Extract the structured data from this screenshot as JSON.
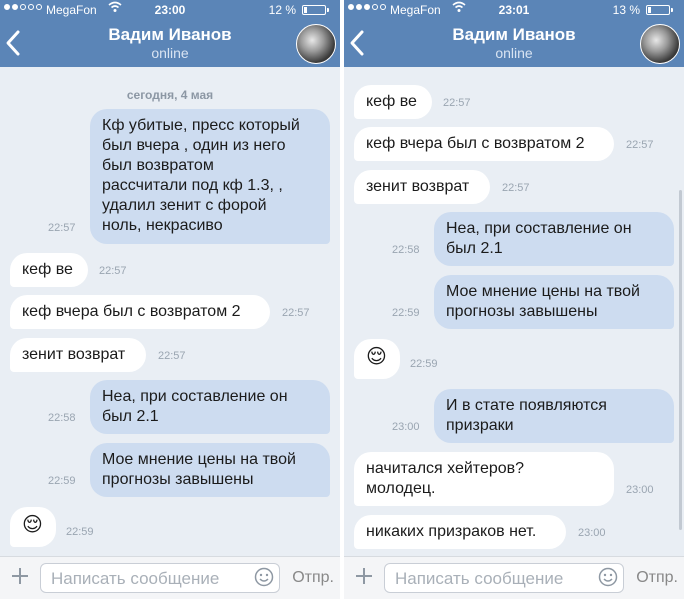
{
  "screens": [
    {
      "status": {
        "carrier": "MegaFon",
        "time": "23:00",
        "battery": "12 %"
      },
      "header": {
        "title": "Вадим Иванов",
        "subtitle": "online"
      },
      "date_separator": "сегодня, 4 мая",
      "messages": [
        {
          "text": "Кф убитые, пресс который\nбыл вчера , один из него\nбыл возвратом\nрассчитали под кф 1.3, ,\nудалил зенит с форой\nноль, некрасиво",
          "time": "22:57"
        },
        {
          "text": "кеф ве",
          "time": "22:57"
        },
        {
          "text": "кеф вчера был с возвратом 2",
          "time": "22:57"
        },
        {
          "text": "зенит возврат",
          "time": "22:57"
        },
        {
          "text": "Неа, при составление он\nбыл 2.1",
          "time": "22:58"
        },
        {
          "text": "Мое мнение цены на твой\nпрогнозы завышены",
          "time": "22:59"
        },
        {
          "text": "😌",
          "time": "22:59"
        }
      ],
      "input": {
        "placeholder": "Написать сообщение",
        "send_label": "Отпр."
      }
    },
    {
      "status": {
        "carrier": "MegaFon",
        "time": "23:01",
        "battery": "13 %"
      },
      "header": {
        "title": "Вадим Иванов",
        "subtitle": "online"
      },
      "messages": [
        {
          "text": "кеф ве",
          "time": "22:57"
        },
        {
          "text": "кеф вчера был с возвратом 2",
          "time": "22:57"
        },
        {
          "text": "зенит возврат",
          "time": "22:57"
        },
        {
          "text": "Неа, при составление он\nбыл 2.1",
          "time": "22:58"
        },
        {
          "text": "Мое мнение цены на твой\nпрогнозы завышены",
          "time": "22:59"
        },
        {
          "text": "😌",
          "time": "22:59"
        },
        {
          "text": "И в стате появляются\nпризраки",
          "time": "23:00"
        },
        {
          "text": "начитался хейтеров?\nмолодец.",
          "time": "23:00"
        },
        {
          "text": "никаких призраков нет.",
          "time": "23:00"
        }
      ],
      "input": {
        "placeholder": "Написать сообщение",
        "send_label": "Отпр."
      }
    }
  ],
  "colors": {
    "header": "#5b85b7",
    "chat_background": "#e9eef4",
    "outgoing_bubble": "#cddcf0",
    "incoming_bubble": "#ffffff"
  },
  "icons": [
    "back-chevron-icon",
    "wifi-icon",
    "battery-icon",
    "plus-icon",
    "smiley-icon"
  ]
}
